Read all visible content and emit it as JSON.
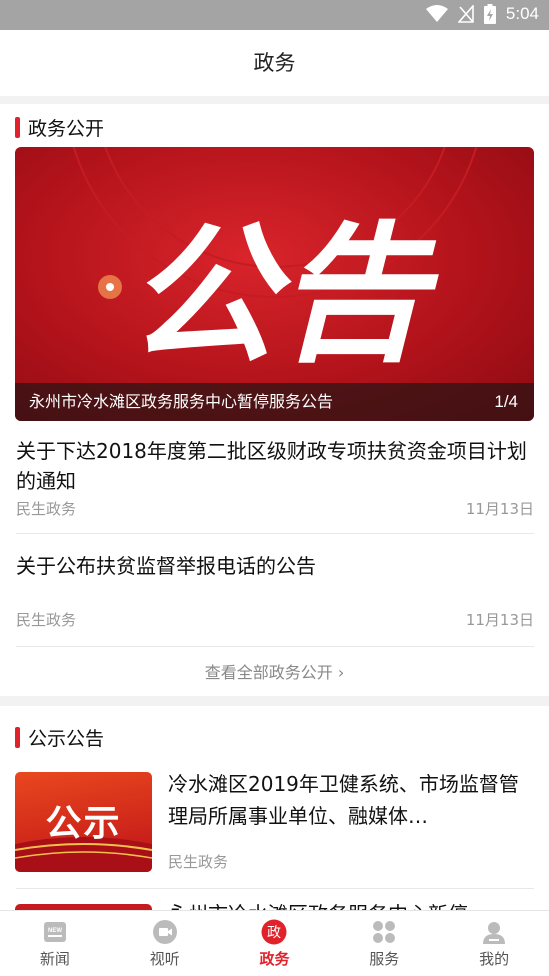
{
  "status_bar": {
    "time": "5:04"
  },
  "header": {
    "title": "政务"
  },
  "section1": {
    "title": "政务公开",
    "banner": {
      "big_text": "公告",
      "caption": "永州市冷水滩区政务服务中心暂停服务公告",
      "counter": "1/4"
    },
    "news": [
      {
        "title": "关于下达2018年度第二批区级财政专项扶贫资金项目计划的通知",
        "source": "民生政务",
        "date": "11月13日"
      },
      {
        "title": "关于公布扶贫监督举报电话的公告",
        "source": "民生政务",
        "date": "11月13日"
      }
    ],
    "view_all": "查看全部政务公开 ›"
  },
  "section2": {
    "title": "公示公告",
    "articles": [
      {
        "thumb_text": "公示",
        "title": "冷水滩区2019年卫健系统、市场监督管理局所属事业单位、融媒体…",
        "source": "民生政务"
      },
      {
        "title": "永州市冷水滩区政务服务中心新停"
      }
    ]
  },
  "tabbar": {
    "tabs": [
      {
        "label": "新闻",
        "icon": "news-icon",
        "active": false
      },
      {
        "label": "视听",
        "icon": "video-icon",
        "active": false
      },
      {
        "label": "政务",
        "icon": "government-icon",
        "active": true,
        "icon_text": "政"
      },
      {
        "label": "服务",
        "icon": "grid-icon",
        "active": false
      },
      {
        "label": "我的",
        "icon": "profile-icon",
        "active": false
      }
    ]
  },
  "colors": {
    "accent": "#e0222b",
    "status_bar": "#a4a4a4"
  }
}
